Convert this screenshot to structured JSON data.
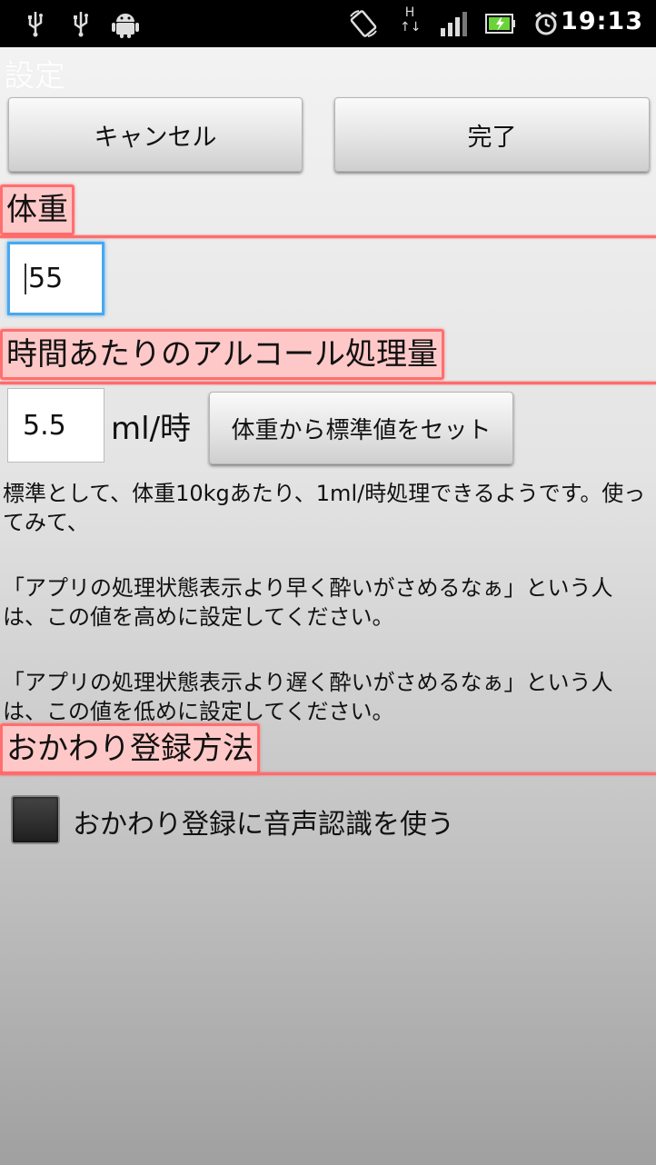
{
  "status_bar": {
    "time": "19:13",
    "network_type": "H",
    "icons": [
      "usb-icon",
      "usb-icon",
      "android-icon",
      "rotation-icon",
      "signal-icon",
      "battery-icon",
      "alarm-icon"
    ]
  },
  "window": {
    "title": "設定"
  },
  "toolbar": {
    "cancel_label": "キャンセル",
    "done_label": "完了"
  },
  "weight_section": {
    "header": "体重",
    "value": "55"
  },
  "alcohol_section": {
    "header": "時間あたりのアルコール処理量",
    "value": "5.5",
    "unit": "ml/時",
    "set_default_label": "体重から標準値をセット",
    "description": [
      "標準として、体重10kgあたり、1ml/時処理できるようです。使ってみて、",
      "「アプリの処理状態表示より早く酔いがさめるなぁ」という人は、この値を高めに設定してください。",
      "「アプリの処理状態表示より遅く酔いがさめるなぁ」という人は、この値を低めに設定してください。"
    ]
  },
  "refill_section": {
    "header": "おかわり登録方法",
    "voice_checkbox_label": "おかわり登録に音声認識を使う",
    "voice_checked": false
  },
  "colors": {
    "section_fill": "#ffc8c8",
    "section_border": "#ff6f6f",
    "focus": "#4aa8ee"
  }
}
